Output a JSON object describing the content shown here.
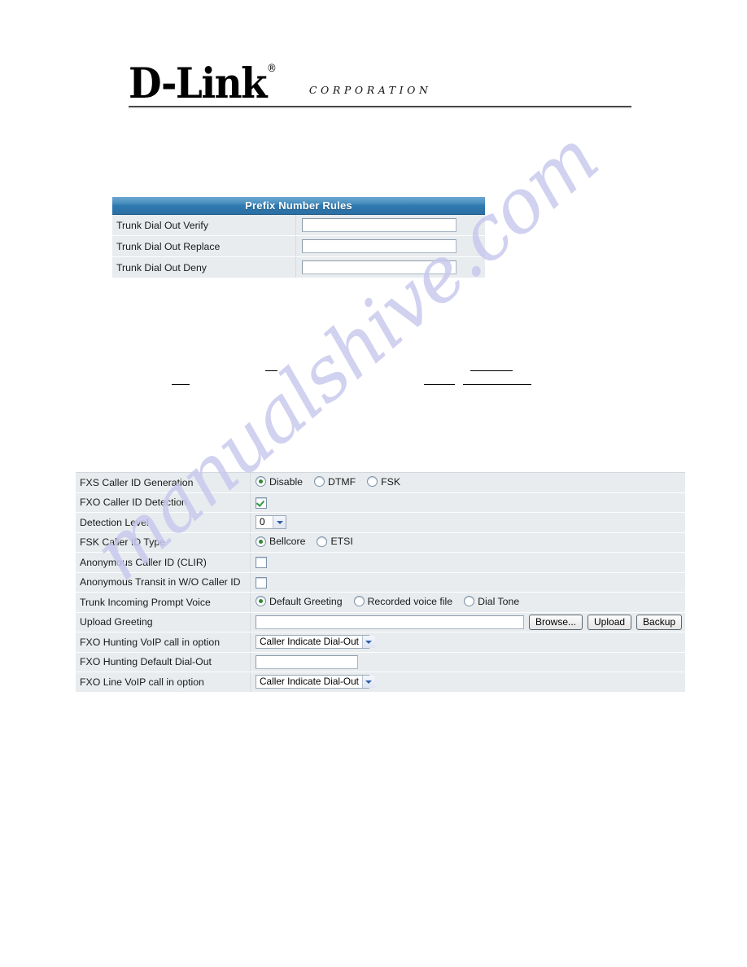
{
  "logo": {
    "brand": "D-Link",
    "registered_mark": "®",
    "tagline": "CORPORATION"
  },
  "watermark": {
    "text": "manualshive.com"
  },
  "prefix_table": {
    "header": "Prefix Number Rules",
    "rows": [
      {
        "label": "Trunk Dial Out Verify",
        "value": ""
      },
      {
        "label": "Trunk Dial Out Replace",
        "value": ""
      },
      {
        "label": "Trunk Dial Out Deny",
        "value": ""
      }
    ]
  },
  "callerid_table": {
    "rows": [
      {
        "label": "FXS Caller ID Generation",
        "type": "radio",
        "options": [
          {
            "label": "Disable",
            "selected": true
          },
          {
            "label": "DTMF",
            "selected": false
          },
          {
            "label": "FSK",
            "selected": false
          }
        ]
      },
      {
        "label": "FXO Caller ID Detection",
        "type": "checkbox",
        "checked": true
      },
      {
        "label": "Detection Level",
        "type": "select",
        "value": "0"
      },
      {
        "label": "FSK Caller ID Type",
        "type": "radio",
        "options": [
          {
            "label": "Bellcore",
            "selected": true
          },
          {
            "label": "ETSI",
            "selected": false
          }
        ]
      },
      {
        "label": "Anonymous Caller ID (CLIR)",
        "type": "checkbox",
        "checked": false
      },
      {
        "label": "Anonymous Transit in W/O Caller ID",
        "type": "checkbox",
        "checked": false
      },
      {
        "label": "Trunk Incoming Prompt Voice",
        "type": "radio",
        "options": [
          {
            "label": "Default Greeting",
            "selected": true
          },
          {
            "label": "Recorded voice file",
            "selected": false
          },
          {
            "label": "Dial Tone",
            "selected": false
          }
        ]
      },
      {
        "label": "Upload Greeting",
        "type": "file_upload",
        "value": "",
        "buttons": [
          "Browse...",
          "Upload",
          "Backup"
        ]
      },
      {
        "label": "FXO Hunting VoIP call in option",
        "type": "select",
        "value": "Caller Indicate Dial-Out"
      },
      {
        "label": "FXO Hunting Default Dial-Out",
        "type": "text",
        "value": ""
      },
      {
        "label": "FXO Line VoIP call in option",
        "type": "select",
        "value": "Caller Indicate Dial-Out"
      }
    ]
  },
  "colors": {
    "header_blue": "#2f7bb2",
    "row_bg": "#e8ecef",
    "watermark": "#c9c9ee",
    "check_green": "#2e9c3e",
    "radio_green": "#2e8b2e"
  }
}
